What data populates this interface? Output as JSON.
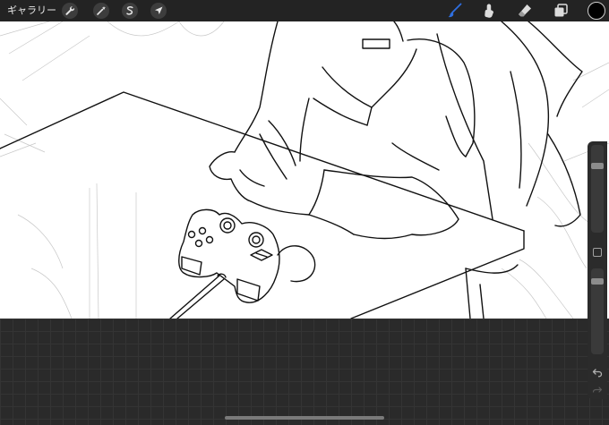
{
  "toolbar": {
    "gallery_label": "ギャラリー",
    "left_tools": [
      "wrench-icon",
      "magic-wand-icon",
      "selection-icon",
      "transform-arrow-icon"
    ],
    "right_tools": [
      "brush-icon",
      "smudge-icon",
      "eraser-icon",
      "layers-icon"
    ],
    "active_tool": "brush-icon",
    "current_color": "#000000"
  },
  "colors": {
    "toolbar_bg": "#232323",
    "accent": "#2f6fe0",
    "canvas_bg": "#ffffff",
    "workspace_bg": "#2a2a2a"
  },
  "sidebar": {
    "brush_size_level": 0.22,
    "opacity_level": 0.12,
    "icons": [
      "modify-button-icon",
      "undo-icon",
      "redo-icon"
    ]
  }
}
